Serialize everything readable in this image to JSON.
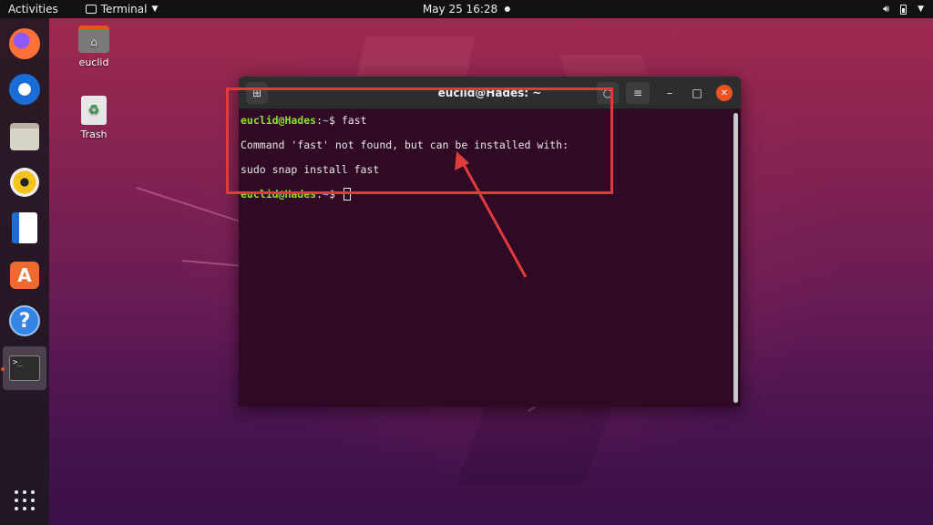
{
  "topbar": {
    "activities": "Activities",
    "app_name": "Terminal",
    "datetime": "May 25  16:28"
  },
  "dock": {
    "items": [
      {
        "name": "Firefox"
      },
      {
        "name": "Thunderbird"
      },
      {
        "name": "Files"
      },
      {
        "name": "Rhythmbox"
      },
      {
        "name": "LibreOffice Writer"
      },
      {
        "name": "Ubuntu Software",
        "glyph": "A"
      },
      {
        "name": "Help",
        "glyph": "?"
      },
      {
        "name": "Terminal",
        "glyph": ">_"
      }
    ]
  },
  "desktop": {
    "home_label": "euclid",
    "trash_label": "Trash"
  },
  "terminal": {
    "title": "euclid@Hades: ~",
    "prompt_user": "euclid@Hades",
    "prompt_path": "~",
    "prompt_symbol": "$",
    "command": "fast",
    "output_line1": "Command 'fast' not found, but can be installed with:",
    "output_line2": "sudo snap install fast"
  },
  "colors": {
    "accent": "#e95420",
    "annotation": "#e23b3b",
    "terminal_bg": "#300a24",
    "prompt_user": "#8ae234",
    "prompt_path": "#729fcf"
  }
}
